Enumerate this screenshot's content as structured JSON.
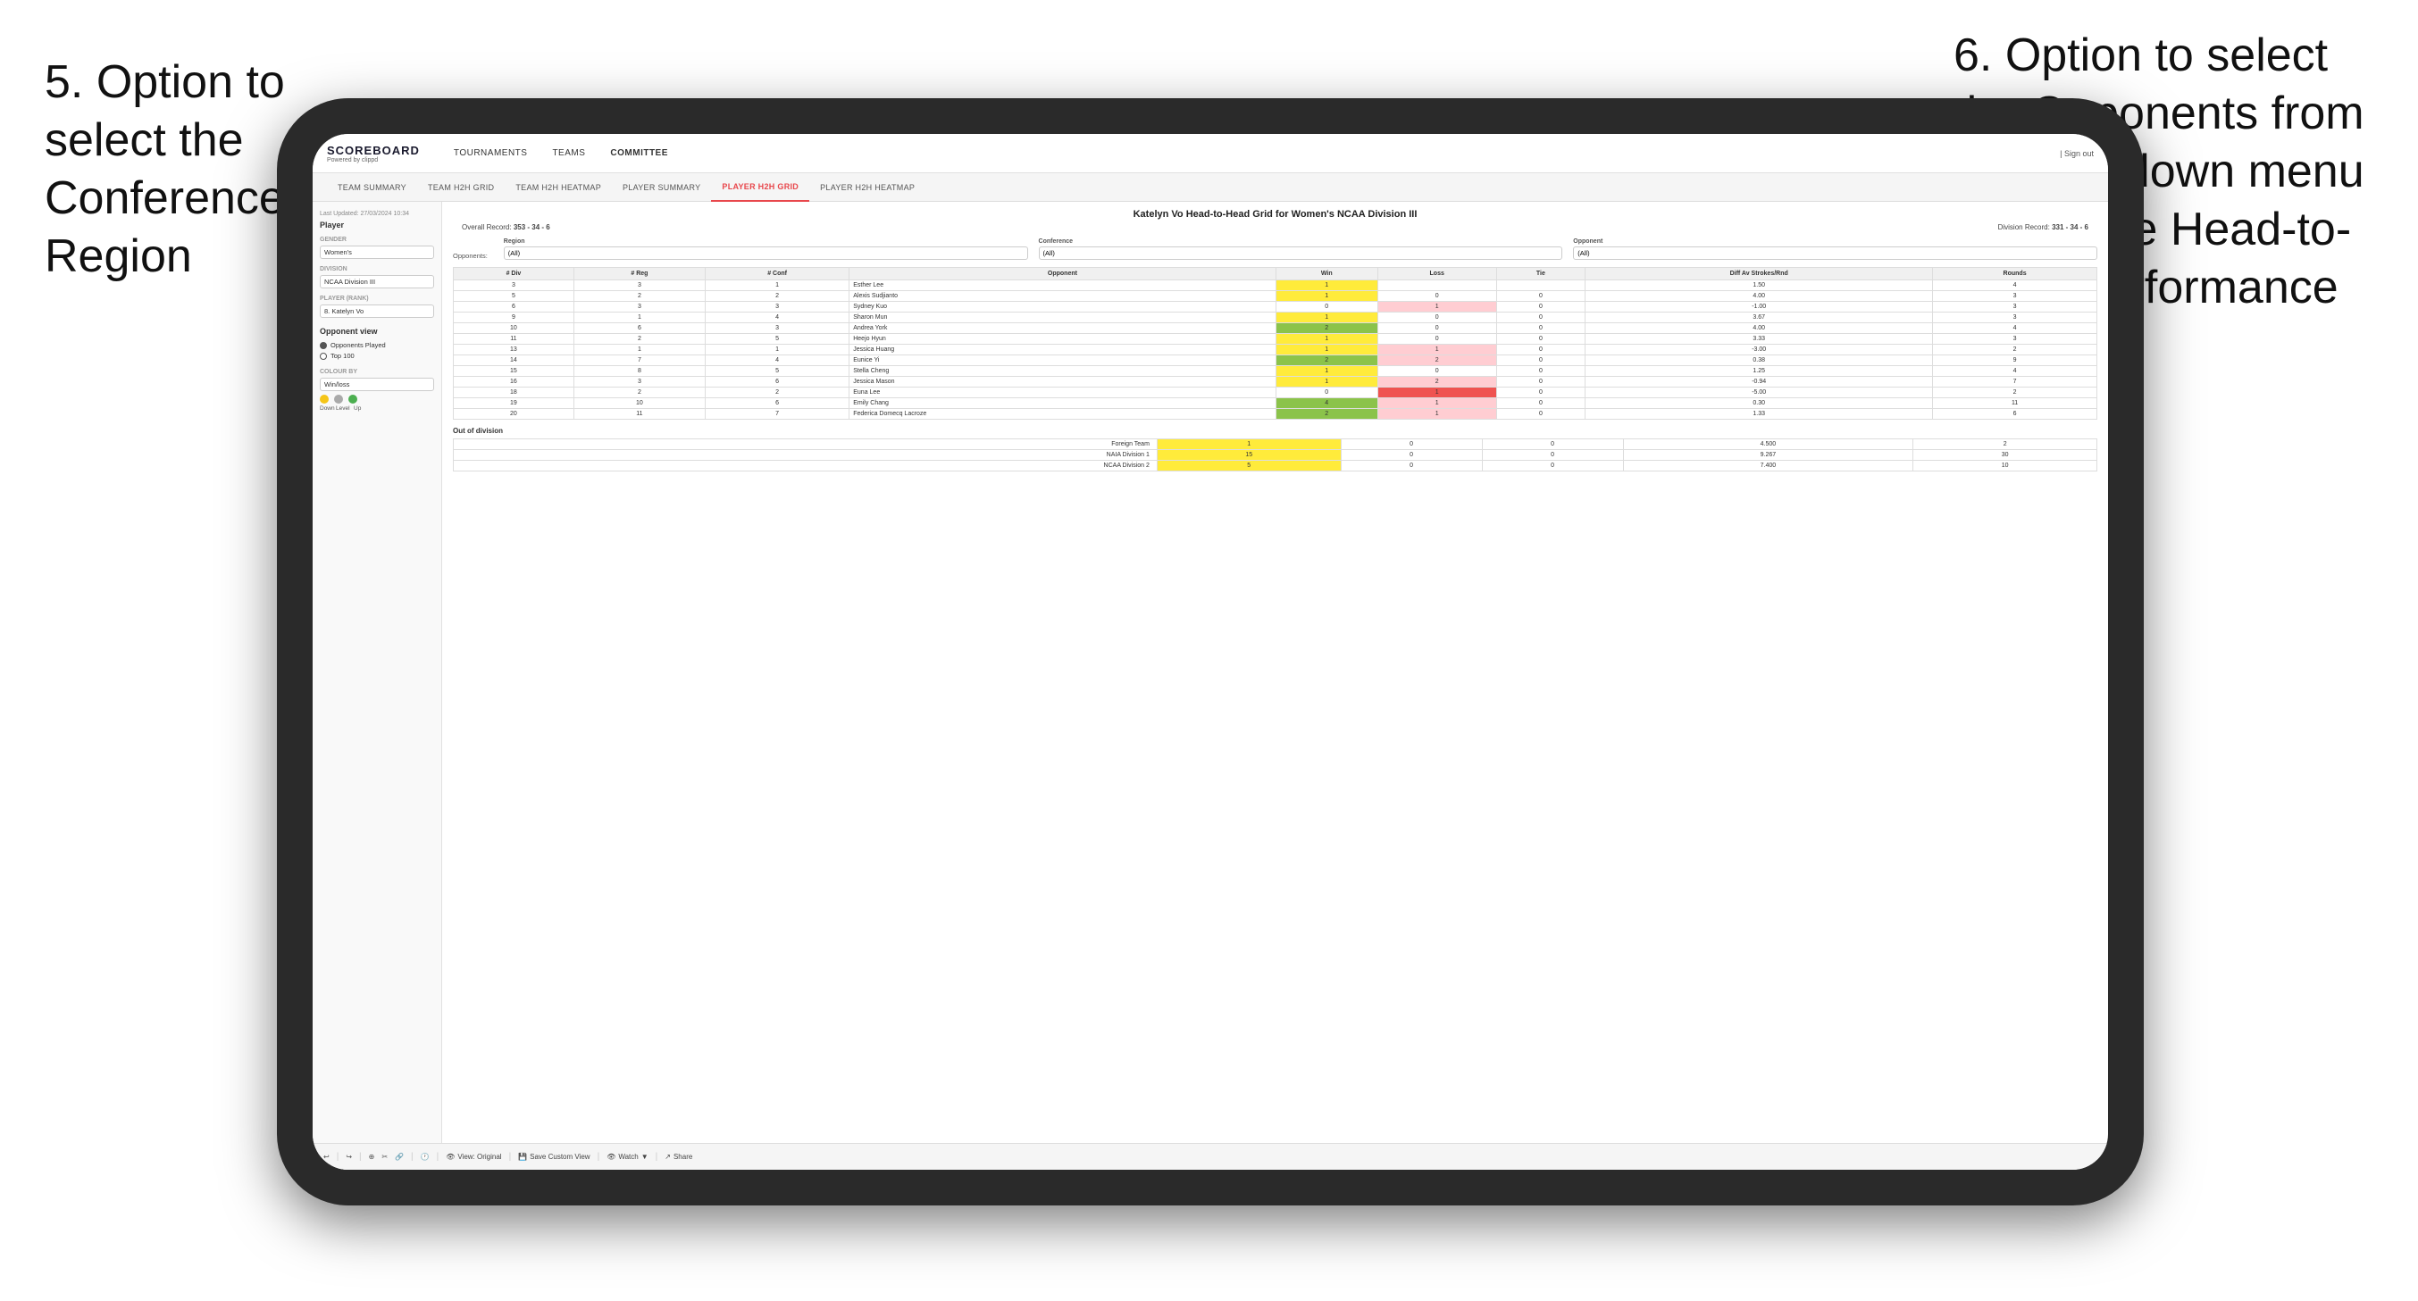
{
  "annotations": {
    "left": {
      "text": "5. Option to select the Conference and Region"
    },
    "right": {
      "text": "6. Option to select the Opponents from the dropdown menu to see the Head-to-Head performance"
    }
  },
  "app": {
    "logo": "SCOREBOARD",
    "logo_sub": "Powered by clippd",
    "sign_out": "Sign out",
    "nav": [
      "TOURNAMENTS",
      "TEAMS",
      "COMMITTEE"
    ],
    "active_nav": "COMMITTEE",
    "sub_nav": [
      "TEAM SUMMARY",
      "TEAM H2H GRID",
      "TEAM H2H HEATMAP",
      "PLAYER SUMMARY",
      "PLAYER H2H GRID",
      "PLAYER H2H HEATMAP"
    ],
    "active_sub_nav": "PLAYER H2H GRID"
  },
  "sidebar": {
    "updated": "Last Updated: 27/03/2024 10:34",
    "player_label": "Player",
    "gender_label": "Gender",
    "gender_value": "Women's",
    "division_label": "Division",
    "division_value": "NCAA Division III",
    "player_rank_label": "Player (Rank)",
    "player_rank_value": "8. Katelyn Vo",
    "opponent_view_label": "Opponent view",
    "radio1": "Opponents Played",
    "radio2": "Top 100",
    "colour_by_label": "Colour by",
    "colour_by_value": "Win/loss",
    "legend": [
      "Down",
      "Level",
      "Up"
    ]
  },
  "main": {
    "title": "Katelyn Vo Head-to-Head Grid for Women's NCAA Division III",
    "overall_record_label": "Overall Record:",
    "overall_record": "353 - 34 - 6",
    "division_record_label": "Division Record:",
    "division_record": "331 - 34 - 6",
    "filters": {
      "opponents_label": "Opponents:",
      "region_label": "Region",
      "region_value": "(All)",
      "conference_label": "Conference",
      "conference_value": "(All)",
      "opponent_label": "Opponent",
      "opponent_value": "(All)"
    },
    "table_headers": [
      "# Div",
      "# Reg",
      "# Conf",
      "Opponent",
      "Win",
      "Loss",
      "Tie",
      "Diff Av Strokes/Rnd",
      "Rounds"
    ],
    "rows": [
      {
        "div": "3",
        "reg": "3",
        "conf": "1",
        "name": "Esther Lee",
        "win": "1",
        "loss": "",
        "tie": "",
        "diff": "1.50",
        "rounds": "4",
        "win_color": "cell-yellow",
        "loss_color": "cell-white",
        "tie_color": "cell-white"
      },
      {
        "div": "5",
        "reg": "2",
        "conf": "2",
        "name": "Alexis Sudjianto",
        "win": "1",
        "loss": "0",
        "tie": "0",
        "diff": "4.00",
        "rounds": "3",
        "win_color": "cell-yellow",
        "loss_color": "cell-white",
        "tie_color": "cell-white"
      },
      {
        "div": "6",
        "reg": "3",
        "conf": "3",
        "name": "Sydney Kuo",
        "win": "0",
        "loss": "1",
        "tie": "0",
        "diff": "-1.00",
        "rounds": "3",
        "win_color": "cell-white",
        "loss_color": "cell-light-red",
        "tie_color": "cell-white"
      },
      {
        "div": "9",
        "reg": "1",
        "conf": "4",
        "name": "Sharon Mun",
        "win": "1",
        "loss": "0",
        "tie": "0",
        "diff": "3.67",
        "rounds": "3",
        "win_color": "cell-yellow",
        "loss_color": "cell-white",
        "tie_color": "cell-white"
      },
      {
        "div": "10",
        "reg": "6",
        "conf": "3",
        "name": "Andrea York",
        "win": "2",
        "loss": "0",
        "tie": "0",
        "diff": "4.00",
        "rounds": "4",
        "win_color": "cell-green",
        "loss_color": "cell-white",
        "tie_color": "cell-white"
      },
      {
        "div": "11",
        "reg": "2",
        "conf": "5",
        "name": "Heejo Hyun",
        "win": "1",
        "loss": "0",
        "tie": "0",
        "diff": "3.33",
        "rounds": "3",
        "win_color": "cell-yellow",
        "loss_color": "cell-white",
        "tie_color": "cell-white"
      },
      {
        "div": "13",
        "reg": "1",
        "conf": "1",
        "name": "Jessica Huang",
        "win": "1",
        "loss": "1",
        "tie": "0",
        "diff": "-3.00",
        "rounds": "2",
        "win_color": "cell-yellow",
        "loss_color": "cell-light-red",
        "tie_color": "cell-white"
      },
      {
        "div": "14",
        "reg": "7",
        "conf": "4",
        "name": "Eunice Yi",
        "win": "2",
        "loss": "2",
        "tie": "0",
        "diff": "0.38",
        "rounds": "9",
        "win_color": "cell-green",
        "loss_color": "cell-light-red",
        "tie_color": "cell-white"
      },
      {
        "div": "15",
        "reg": "8",
        "conf": "5",
        "name": "Stella Cheng",
        "win": "1",
        "loss": "0",
        "tie": "0",
        "diff": "1.25",
        "rounds": "4",
        "win_color": "cell-yellow",
        "loss_color": "cell-white",
        "tie_color": "cell-white"
      },
      {
        "div": "16",
        "reg": "3",
        "conf": "6",
        "name": "Jessica Mason",
        "win": "1",
        "loss": "2",
        "tie": "0",
        "diff": "-0.94",
        "rounds": "7",
        "win_color": "cell-yellow",
        "loss_color": "cell-light-red",
        "tie_color": "cell-white"
      },
      {
        "div": "18",
        "reg": "2",
        "conf": "2",
        "name": "Euna Lee",
        "win": "0",
        "loss": "1",
        "tie": "0",
        "diff": "-5.00",
        "rounds": "2",
        "win_color": "cell-white",
        "loss_color": "cell-red",
        "tie_color": "cell-white"
      },
      {
        "div": "19",
        "reg": "10",
        "conf": "6",
        "name": "Emily Chang",
        "win": "4",
        "loss": "1",
        "tie": "0",
        "diff": "0.30",
        "rounds": "11",
        "win_color": "cell-green",
        "loss_color": "cell-light-red",
        "tie_color": "cell-white"
      },
      {
        "div": "20",
        "reg": "11",
        "conf": "7",
        "name": "Federica Domecq Lacroze",
        "win": "2",
        "loss": "1",
        "tie": "0",
        "diff": "1.33",
        "rounds": "6",
        "win_color": "cell-green",
        "loss_color": "cell-light-red",
        "tie_color": "cell-white"
      }
    ],
    "out_of_division_label": "Out of division",
    "ood_rows": [
      {
        "name": "Foreign Team",
        "win": "1",
        "loss": "0",
        "tie": "0",
        "diff": "4.500",
        "rounds": "2"
      },
      {
        "name": "NAIA Division 1",
        "win": "15",
        "loss": "0",
        "tie": "0",
        "diff": "9.267",
        "rounds": "30"
      },
      {
        "name": "NCAA Division 2",
        "win": "5",
        "loss": "0",
        "tie": "0",
        "diff": "7.400",
        "rounds": "10"
      }
    ]
  },
  "toolbar": {
    "view_original": "View: Original",
    "save_custom": "Save Custom View",
    "watch": "Watch",
    "share": "Share"
  }
}
